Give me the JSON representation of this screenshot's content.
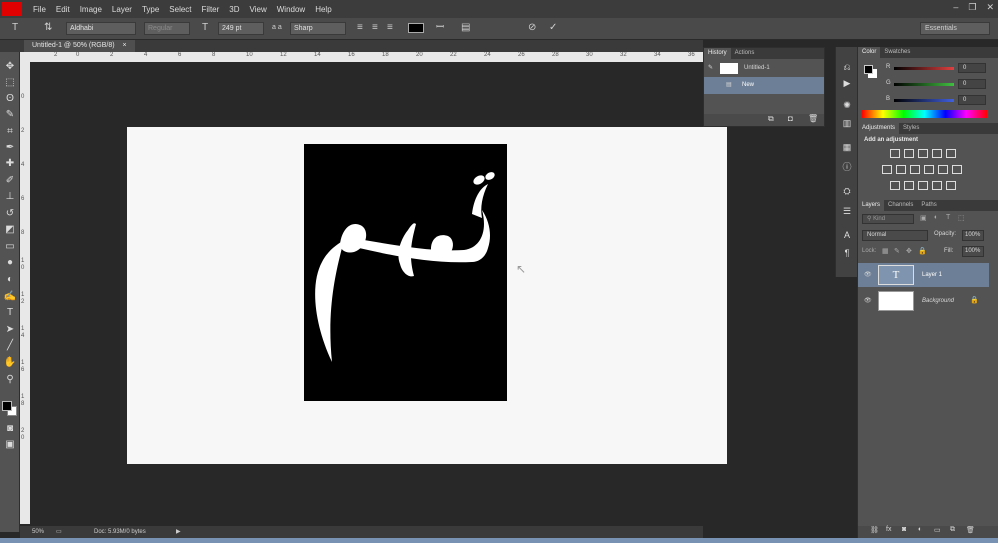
{
  "menubar": {
    "items": [
      "File",
      "Edit",
      "Image",
      "Layer",
      "Type",
      "Select",
      "Filter",
      "3D",
      "View",
      "Window",
      "Help"
    ]
  },
  "options": {
    "font_family": "Aldhabi",
    "font_style": "Regular",
    "font_size": "249 pt",
    "aa_label": "a a",
    "aa_method": "Sharp",
    "workspace": "Essentials"
  },
  "document": {
    "tab_title": "Untitled-1 @ 50% (RGB/8)",
    "text_content": "تمام",
    "zoom": "50%",
    "doc_info": "Doc: 5.93M/0 bytes"
  },
  "ruler": {
    "top": [
      "2",
      "0",
      "2",
      "4",
      "6",
      "8",
      "10",
      "12",
      "14",
      "16",
      "18",
      "20",
      "22",
      "24",
      "26",
      "28",
      "30",
      "32",
      "34",
      "36"
    ],
    "left": [
      "0",
      "2",
      "4",
      "6",
      "8",
      "1",
      "0",
      "1",
      "2",
      "1",
      "4",
      "1",
      "6",
      "1",
      "8",
      "2",
      "0"
    ]
  },
  "history": {
    "tabs": [
      "History",
      "Actions"
    ],
    "snapshot": "Untitled-1",
    "state": "New"
  },
  "color_panel": {
    "tabs": [
      "Color",
      "Swatches"
    ],
    "channels": [
      {
        "label": "R",
        "value": "0",
        "color": "#e04040"
      },
      {
        "label": "G",
        "value": "0",
        "color": "#40c040"
      },
      {
        "label": "B",
        "value": "0",
        "color": "#4060e0"
      }
    ]
  },
  "adjustments": {
    "tabs": [
      "Adjustments",
      "Styles"
    ],
    "heading": "Add an adjustment"
  },
  "layers": {
    "tabs": [
      "Layers",
      "Channels",
      "Paths"
    ],
    "filter_kind": "Kind",
    "blend_mode": "Normal",
    "opacity_label": "Opacity:",
    "opacity": "100%",
    "lock_label": "Lock:",
    "fill_label": "Fill:",
    "fill": "100%",
    "items": [
      {
        "name": "Layer 1",
        "thumb": "T"
      },
      {
        "name": "Background",
        "thumb": ""
      }
    ]
  }
}
